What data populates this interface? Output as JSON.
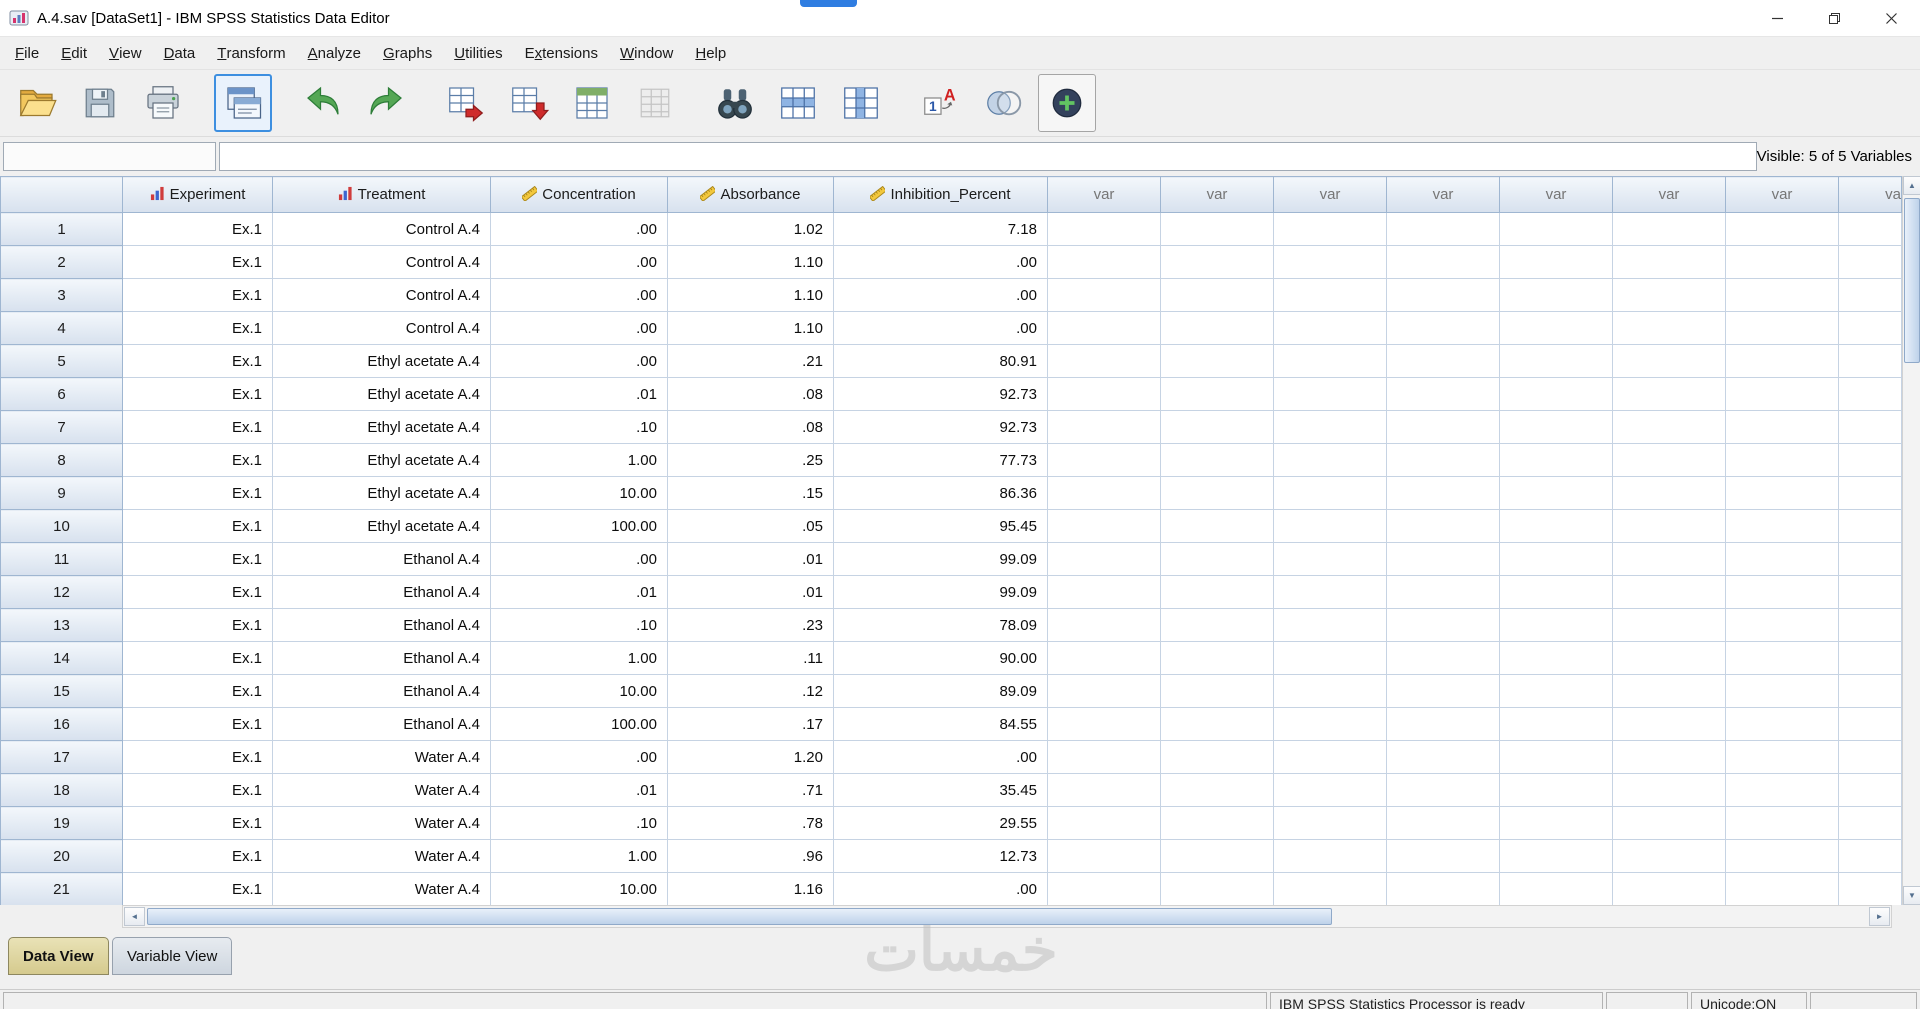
{
  "window": {
    "title": "A.4.sav [DataSet1] - IBM SPSS Statistics Data Editor"
  },
  "menu": {
    "items": [
      {
        "label": "File",
        "accel": 0
      },
      {
        "label": "Edit",
        "accel": 0
      },
      {
        "label": "View",
        "accel": 0
      },
      {
        "label": "Data",
        "accel": 0
      },
      {
        "label": "Transform",
        "accel": 0
      },
      {
        "label": "Analyze",
        "accel": 0
      },
      {
        "label": "Graphs",
        "accel": 0
      },
      {
        "label": "Utilities",
        "accel": 0
      },
      {
        "label": "Extensions",
        "accel": 1
      },
      {
        "label": "Window",
        "accel": 0
      },
      {
        "label": "Help",
        "accel": 0
      }
    ]
  },
  "toolbar": {
    "buttons": [
      {
        "name": "open-data",
        "icon": "folder-open"
      },
      {
        "name": "save",
        "icon": "floppy"
      },
      {
        "name": "print",
        "icon": "printer"
      },
      {
        "name": "recall-dialogs",
        "icon": "dialog-recall",
        "focused": true
      },
      {
        "name": "undo",
        "icon": "undo-arrow"
      },
      {
        "name": "redo",
        "icon": "redo-arrow"
      },
      {
        "name": "goto-case",
        "icon": "table-arrow-right"
      },
      {
        "name": "goto-variable",
        "icon": "table-arrow-down"
      },
      {
        "name": "variables",
        "icon": "table-variables"
      },
      {
        "name": "split-file",
        "icon": "table-gray"
      },
      {
        "name": "find",
        "icon": "binoculars"
      },
      {
        "name": "insert-cases",
        "icon": "table-insert-row"
      },
      {
        "name": "insert-variables",
        "icon": "table-insert-column"
      },
      {
        "name": "value-labels",
        "icon": "value-labels"
      },
      {
        "name": "select-cases",
        "icon": "overlap-circles"
      },
      {
        "name": "use-variable-sets",
        "icon": "circle-plus",
        "framed": true
      }
    ]
  },
  "cellbar": {
    "cell_reference": "",
    "cell_value": "",
    "visible_label": "Visible: 5 of 5 Variables"
  },
  "grid": {
    "columns": [
      {
        "label": "Experiment",
        "measure": "nominal"
      },
      {
        "label": "Treatment",
        "measure": "nominal"
      },
      {
        "label": "Concentration",
        "measure": "scale"
      },
      {
        "label": "Absorbance",
        "measure": "scale"
      },
      {
        "label": "Inhibition_Percent",
        "measure": "scale"
      }
    ],
    "var_placeholder": "var",
    "empty_var_count": 7,
    "rows": [
      {
        "n": "1",
        "cells": [
          "Ex.1",
          "Control A.4",
          ".00",
          "1.02",
          "7.18"
        ]
      },
      {
        "n": "2",
        "cells": [
          "Ex.1",
          "Control A.4",
          ".00",
          "1.10",
          ".00"
        ]
      },
      {
        "n": "3",
        "cells": [
          "Ex.1",
          "Control A.4",
          ".00",
          "1.10",
          ".00"
        ]
      },
      {
        "n": "4",
        "cells": [
          "Ex.1",
          "Control A.4",
          ".00",
          "1.10",
          ".00"
        ]
      },
      {
        "n": "5",
        "cells": [
          "Ex.1",
          "Ethyl acetate A.4",
          ".00",
          ".21",
          "80.91"
        ]
      },
      {
        "n": "6",
        "cells": [
          "Ex.1",
          "Ethyl acetate A.4",
          ".01",
          ".08",
          "92.73"
        ]
      },
      {
        "n": "7",
        "cells": [
          "Ex.1",
          "Ethyl acetate A.4",
          ".10",
          ".08",
          "92.73"
        ]
      },
      {
        "n": "8",
        "cells": [
          "Ex.1",
          "Ethyl acetate A.4",
          "1.00",
          ".25",
          "77.73"
        ]
      },
      {
        "n": "9",
        "cells": [
          "Ex.1",
          "Ethyl acetate A.4",
          "10.00",
          ".15",
          "86.36"
        ]
      },
      {
        "n": "10",
        "cells": [
          "Ex.1",
          "Ethyl acetate A.4",
          "100.00",
          ".05",
          "95.45"
        ]
      },
      {
        "n": "11",
        "cells": [
          "Ex.1",
          "Ethanol A.4",
          ".00",
          ".01",
          "99.09"
        ]
      },
      {
        "n": "12",
        "cells": [
          "Ex.1",
          "Ethanol A.4",
          ".01",
          ".01",
          "99.09"
        ]
      },
      {
        "n": "13",
        "cells": [
          "Ex.1",
          "Ethanol A.4",
          ".10",
          ".23",
          "78.09"
        ]
      },
      {
        "n": "14",
        "cells": [
          "Ex.1",
          "Ethanol A.4",
          "1.00",
          ".11",
          "90.00"
        ]
      },
      {
        "n": "15",
        "cells": [
          "Ex.1",
          "Ethanol A.4",
          "10.00",
          ".12",
          "89.09"
        ]
      },
      {
        "n": "16",
        "cells": [
          "Ex.1",
          "Ethanol A.4",
          "100.00",
          ".17",
          "84.55"
        ]
      },
      {
        "n": "17",
        "cells": [
          "Ex.1",
          "Water A.4",
          ".00",
          "1.20",
          ".00"
        ]
      },
      {
        "n": "18",
        "cells": [
          "Ex.1",
          "Water A.4",
          ".01",
          ".71",
          "35.45"
        ]
      },
      {
        "n": "19",
        "cells": [
          "Ex.1",
          "Water A.4",
          ".10",
          ".78",
          "29.55"
        ]
      },
      {
        "n": "20",
        "cells": [
          "Ex.1",
          "Water A.4",
          "1.00",
          ".96",
          "12.73"
        ]
      },
      {
        "n": "21",
        "cells": [
          "Ex.1",
          "Water A.4",
          "10.00",
          "1.16",
          ".00"
        ]
      }
    ]
  },
  "tabs": {
    "data_view": "Data View",
    "variable_view": "Variable View",
    "active": "Data View"
  },
  "status": {
    "processor": "IBM SPSS Statistics Processor is ready",
    "unicode": "Unicode:ON"
  },
  "watermark": "خمسات",
  "colors": {
    "header_bg_top": "#f3f7fb",
    "header_bg_bottom": "#d7e1ee",
    "header_border": "#9fb6d1",
    "grid_line": "#c6d3e3",
    "focus_accent": "#3d8fe0",
    "tab_active_bg": "#d5ca8e",
    "watermark_color": "#bfbfbf"
  }
}
